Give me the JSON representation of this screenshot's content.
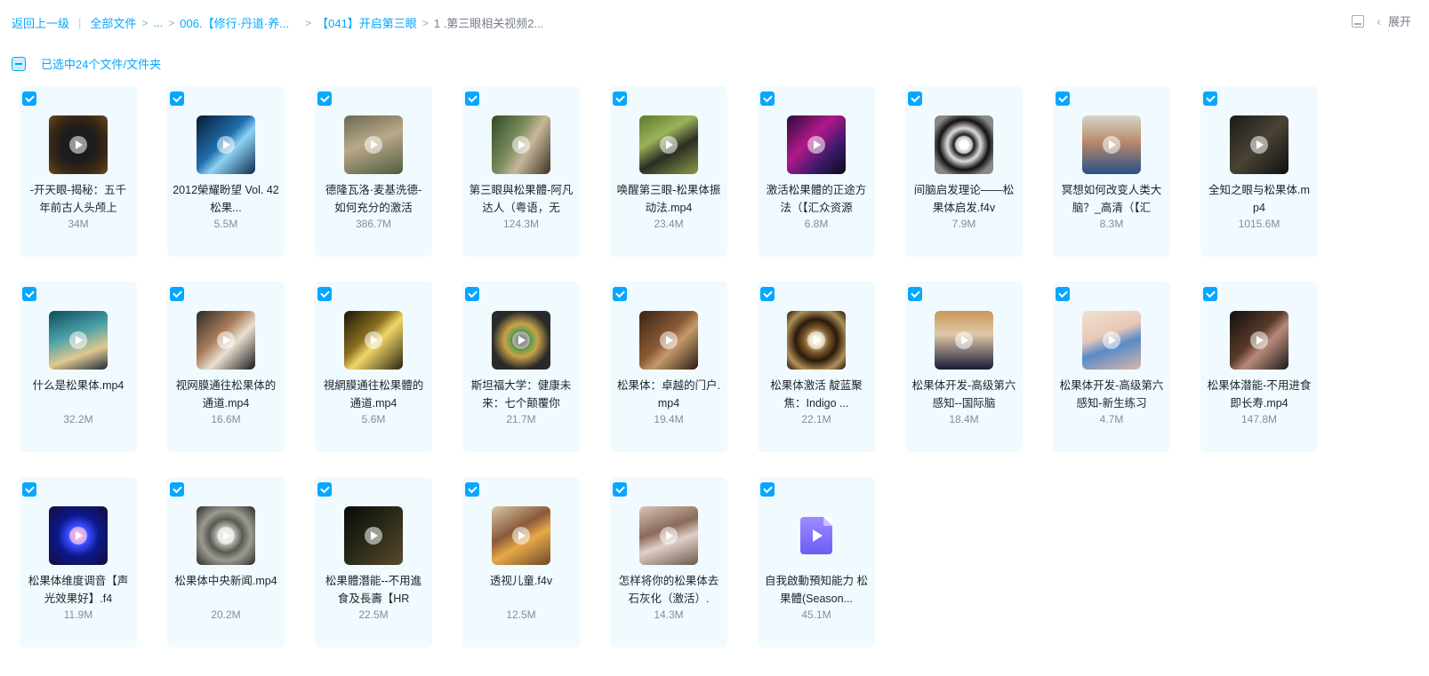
{
  "breadcrumb": {
    "back": "返回上一级",
    "all_files": "全部文件",
    "ellipsis": "...",
    "path1": "006.【修行·丹道·养...",
    "path2": "【041】开启第三眼",
    "current": "1 .第三眼相关视频2..."
  },
  "topbar": {
    "expand_label": "展开",
    "view_icon": "list-view-icon",
    "expand_icon": "chevron-left-icon"
  },
  "selection": {
    "text": "已选中24个文件/文件夹"
  },
  "colors": {
    "accent": "#06a7ff",
    "card_bg": "#f0faff"
  },
  "files": [
    {
      "name": "-开天眼-揭秘：五千年前古人头颅上",
      "size": "34M",
      "thumb": "dark-globe"
    },
    {
      "name": "2012榮耀盼望 Vol. 42 松果...",
      "size": "5.5M",
      "thumb": "blue-brain"
    },
    {
      "name": "德隆瓦洛·麦基洗德-如何充分的激活",
      "size": "386.7M",
      "thumb": "man-portrait"
    },
    {
      "name": "第三眼與松果體-阿凡达人（粤语，无",
      "size": "124.3M",
      "thumb": "studio-people"
    },
    {
      "name": "唤醒第三眼-松果体振动法.mp4",
      "size": "23.4M",
      "thumb": "man-outdoor"
    },
    {
      "name": "激活松果體的正途方法（【汇众资源",
      "size": "6.8M",
      "thumb": "purple-space"
    },
    {
      "name": "间脑启发理论——松果体启发.f4v",
      "size": "7.9M",
      "thumb": "spiral-clock"
    },
    {
      "name": "冥想如何改变人类大脑？_高清（【汇",
      "size": "8.3M",
      "thumb": "speaker-man"
    },
    {
      "name": "全知之眼与松果体.mp4",
      "size": "1015.6M",
      "thumb": "dark-scene"
    },
    {
      "name": "什么是松果体.mp4",
      "size": "32.2M",
      "thumb": "ocean-art"
    },
    {
      "name": "视网膜通往松果体的通道.mp4",
      "size": "16.6M",
      "thumb": "video-grid"
    },
    {
      "name": "視網膜通往松果體的通道.mp4",
      "size": "5.6M",
      "thumb": "eat-the-sun"
    },
    {
      "name": "斯坦福大学：健康未来：七个颠覆你",
      "size": "21.7M",
      "thumb": "eye-closeup"
    },
    {
      "name": "松果体：卓越的门户.mp4",
      "size": "19.4M",
      "thumb": "text-slide"
    },
    {
      "name": "松果体激活 靛蓝聚焦：Indigo ...",
      "size": "22.1M",
      "thumb": "fractal"
    },
    {
      "name": "松果体开发-高级第六感知--国际脑",
      "size": "18.4M",
      "thumb": "presenter"
    },
    {
      "name": "松果体开发-高级第六感知-新生练习",
      "size": "4.7M",
      "thumb": "room-corner"
    },
    {
      "name": "松果体潜能-不用进食即长寿.mp4",
      "size": "147.8M",
      "thumb": "dark-face"
    },
    {
      "name": "松果体维度调音【声光效果好】.f4",
      "size": "11.9M",
      "thumb": "blue-mandala"
    },
    {
      "name": "松果体中央新闻.mp4",
      "size": "20.2M",
      "thumb": "grey-clock"
    },
    {
      "name": "松果體潛能--不用進食及長壽【HR",
      "size": "22.5M",
      "thumb": "uk-flag"
    },
    {
      "name": "透视儿童.f4v",
      "size": "12.5M",
      "thumb": "child"
    },
    {
      "name": "怎样将你的松果体去石灰化（激活）.",
      "size": "14.3M",
      "thumb": "woman-face"
    },
    {
      "name": "自我啟動預知能力 松果體(Season...",
      "size": "45.1M",
      "thumb": "generic"
    }
  ]
}
